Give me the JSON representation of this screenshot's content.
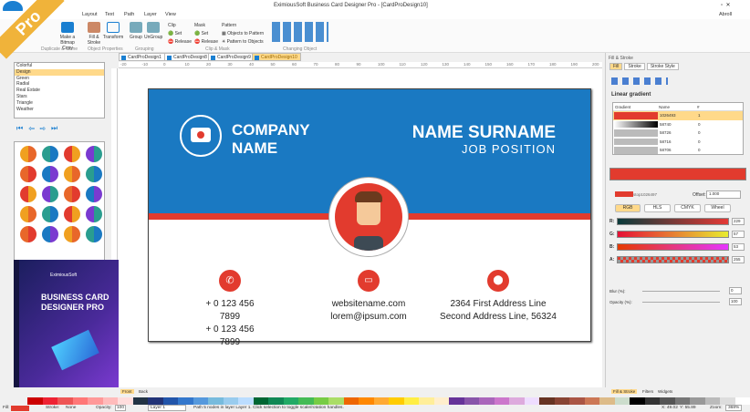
{
  "app": {
    "title": "EximiousSoft Business Card Designer Pro - [CardProDesign10]",
    "user": "Abroll",
    "badge": "Pro"
  },
  "menu": [
    "Layout",
    "Text",
    "Path",
    "Layer",
    "View"
  ],
  "ribbon": {
    "buttons": [
      {
        "label": "Make a Bitmap Copy",
        "icon": "camera-icon"
      },
      {
        "label": "Fill & Stroke",
        "icon": "fill-stroke-icon"
      },
      {
        "label": "Transform",
        "icon": "transform-icon"
      },
      {
        "label": "Group",
        "icon": "group-icon"
      },
      {
        "label": "UnGroup",
        "icon": "ungroup-icon"
      }
    ],
    "clip": {
      "title": "Clip",
      "set": "Set",
      "release": "Release"
    },
    "mask": {
      "title": "Mask",
      "set": "Set",
      "release": "Release"
    },
    "pattern": {
      "title": "Pattern",
      "to": "Objects to Pattern",
      "from": "Pattern to Objects"
    },
    "groups": [
      "Duplicate & Clone",
      "Object Properties",
      "Grouping",
      "Clip & Mask",
      "Changing Object"
    ]
  },
  "tabs": [
    "CardProDesign1",
    "CardProDesign8",
    "CardProDesign9",
    "CardProDesign10"
  ],
  "ruler": [
    "-20",
    "-10",
    "0",
    "10",
    "20",
    "30",
    "40",
    "50",
    "60",
    "70",
    "80",
    "90",
    "100",
    "110",
    "120",
    "130",
    "140",
    "150",
    "160",
    "170",
    "180",
    "190",
    "200"
  ],
  "left": {
    "categories": [
      "Colorful",
      "Design",
      "Green",
      "Radial",
      "Real Estate",
      "Stars",
      "Triangle",
      "Weather"
    ],
    "selected": 1,
    "box": {
      "brand": "EximiousSoft",
      "line1": "BUSINESS CARD",
      "line2": "DESIGNER PRO"
    }
  },
  "card": {
    "company1": "COMPANY",
    "company2": "NAME",
    "name": "NAME SURNAME",
    "position": "JOB POSITION",
    "phone1": "+ 0 123 456 7899",
    "phone2": "+ 0 123 456 7899",
    "web": "websitename.com",
    "email": "lorem@ipsum.com",
    "addr1": "2364 First Address Line",
    "addr2": "Second Address Line, 56324"
  },
  "right": {
    "title": "Fill & Stroke",
    "tabs": [
      "Fill",
      "Stroke",
      "Stroke Style"
    ],
    "gradient_title": "Linear gradient",
    "cols": [
      "Gradient",
      "Name",
      "#"
    ],
    "rows": [
      {
        "name": "1026493",
        "n": "1"
      },
      {
        "name": "58740",
        "n": "0"
      },
      {
        "name": "58726",
        "n": "0"
      },
      {
        "name": "58716",
        "n": "0"
      },
      {
        "name": "58706",
        "n": "0"
      }
    ],
    "stop": "stop1026497",
    "offset_label": "Offset:",
    "offset": "1.000",
    "modes": [
      "RGB",
      "HLS",
      "CMYK",
      "Wheel"
    ],
    "channels": [
      {
        "l": "R:",
        "v": "229"
      },
      {
        "l": "G:",
        "v": "57"
      },
      {
        "l": "B:",
        "v": "53"
      },
      {
        "l": "A:",
        "v": "255"
      }
    ],
    "blur_label": "Blur (%):",
    "blur": "0",
    "opacity_label": "Opacity (%):",
    "opacity": "100",
    "bottom_tabs": [
      "Fill & Stroke",
      "Filters",
      "Widgets"
    ]
  },
  "pages": [
    "Front",
    "Back"
  ],
  "status": {
    "fill": "Fill:",
    "stroke": "Stroke:",
    "stroke_val": "None",
    "opacity_label": "Opacity:",
    "opacity": "100",
    "layer": "Layer 1",
    "message": "Path 5 nodes in layer Layer 1. Click selection to toggle scale/rotation handles.",
    "x": "X: 49.02",
    "y": "Y: 55.89",
    "zoom_label": "Zoom:",
    "zoom": "368%"
  },
  "colors": {
    "blue": "#1a79c2",
    "red": "#e23b2e"
  }
}
